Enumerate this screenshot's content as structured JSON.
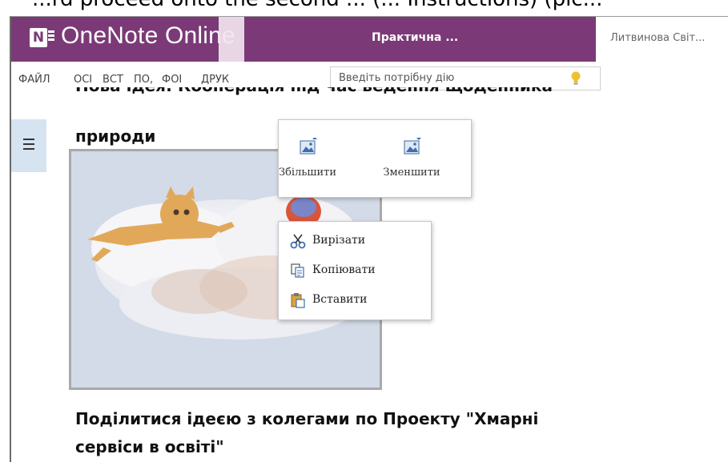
{
  "caption_cut": "...rd proceed onto the second ... (... Instructions) (pic...",
  "app": {
    "title": "OneNote Online",
    "notebook": "Практична ...",
    "user": "Литвинова Світ..."
  },
  "ribbon": {
    "tabs": [
      "ФАЙЛ",
      "ОСІ",
      "ВСТ",
      "ПО,",
      "ФОІ",
      "ДРУК"
    ],
    "search_placeholder": "Введіть потрібну дію"
  },
  "page": {
    "heading_line1": "Нова ідея: Кооперація під час ведення щоденника",
    "heading_line2": "природи",
    "para_line1": "Поділитися ідеєю з колегами по Проекту \"Хмарні",
    "para_line2": "сервіси в освіті\""
  },
  "resize_menu": {
    "enlarge": "Збільшити",
    "shrink": "Зменшити"
  },
  "context_menu": {
    "cut": "Вирізати",
    "copy": "Копіювати",
    "paste": "Вставити"
  },
  "colors": {
    "title_bar": "#7b3a77",
    "sidebar_button": "#d6e3f0"
  },
  "icons": [
    "notebook-logo-icon",
    "hamburger-icon",
    "lightbulb-icon",
    "enlarge-picture-icon",
    "shrink-picture-icon",
    "scissors-icon",
    "copy-icon",
    "paste-icon"
  ]
}
